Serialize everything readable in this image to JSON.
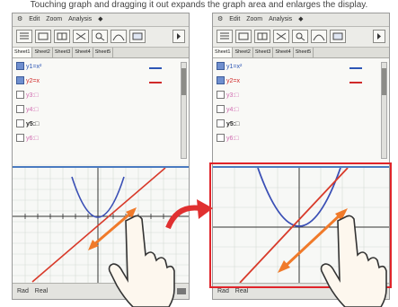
{
  "caption": "Touching graph and dragging it out expands the graph area and enlarges the display.",
  "menu": {
    "settings_glyph": "⚙",
    "items": [
      "Edit",
      "Zoom",
      "Analysis",
      "◆"
    ]
  },
  "tabs": [
    "Sheet1",
    "Sheet2",
    "Sheet3",
    "Sheet4",
    "Sheet5"
  ],
  "functions": [
    {
      "checked": true,
      "text": "y1=x²",
      "color": "#2d56b5"
    },
    {
      "checked": true,
      "text": "y2=x",
      "color": "#d02a2a"
    },
    {
      "checked": false,
      "text": "y3:□",
      "color": "#d06ab0"
    },
    {
      "checked": false,
      "text": "y4:□",
      "color": "#d06ab0"
    },
    {
      "checked": false,
      "text": "y5:□",
      "color": "#222222"
    },
    {
      "checked": false,
      "text": "y6:□",
      "color": "#d06ab0"
    }
  ],
  "status": {
    "left": "Rad",
    "right": "Real"
  },
  "colors": {
    "accent_border": "#4a7ac0",
    "highlight_frame": "#e0242a",
    "parabola": "#3a4fb5",
    "line": "#d83a2a",
    "pinch_arrow": "#f07a2a",
    "transition_arrow": "#e03030"
  },
  "icons": [
    "gear-icon",
    "toolbar-icon",
    "scroll-arrow-icon",
    "battery-icon",
    "pinch-arrow-icon",
    "hand-icon",
    "transition-arrow-icon"
  ]
}
